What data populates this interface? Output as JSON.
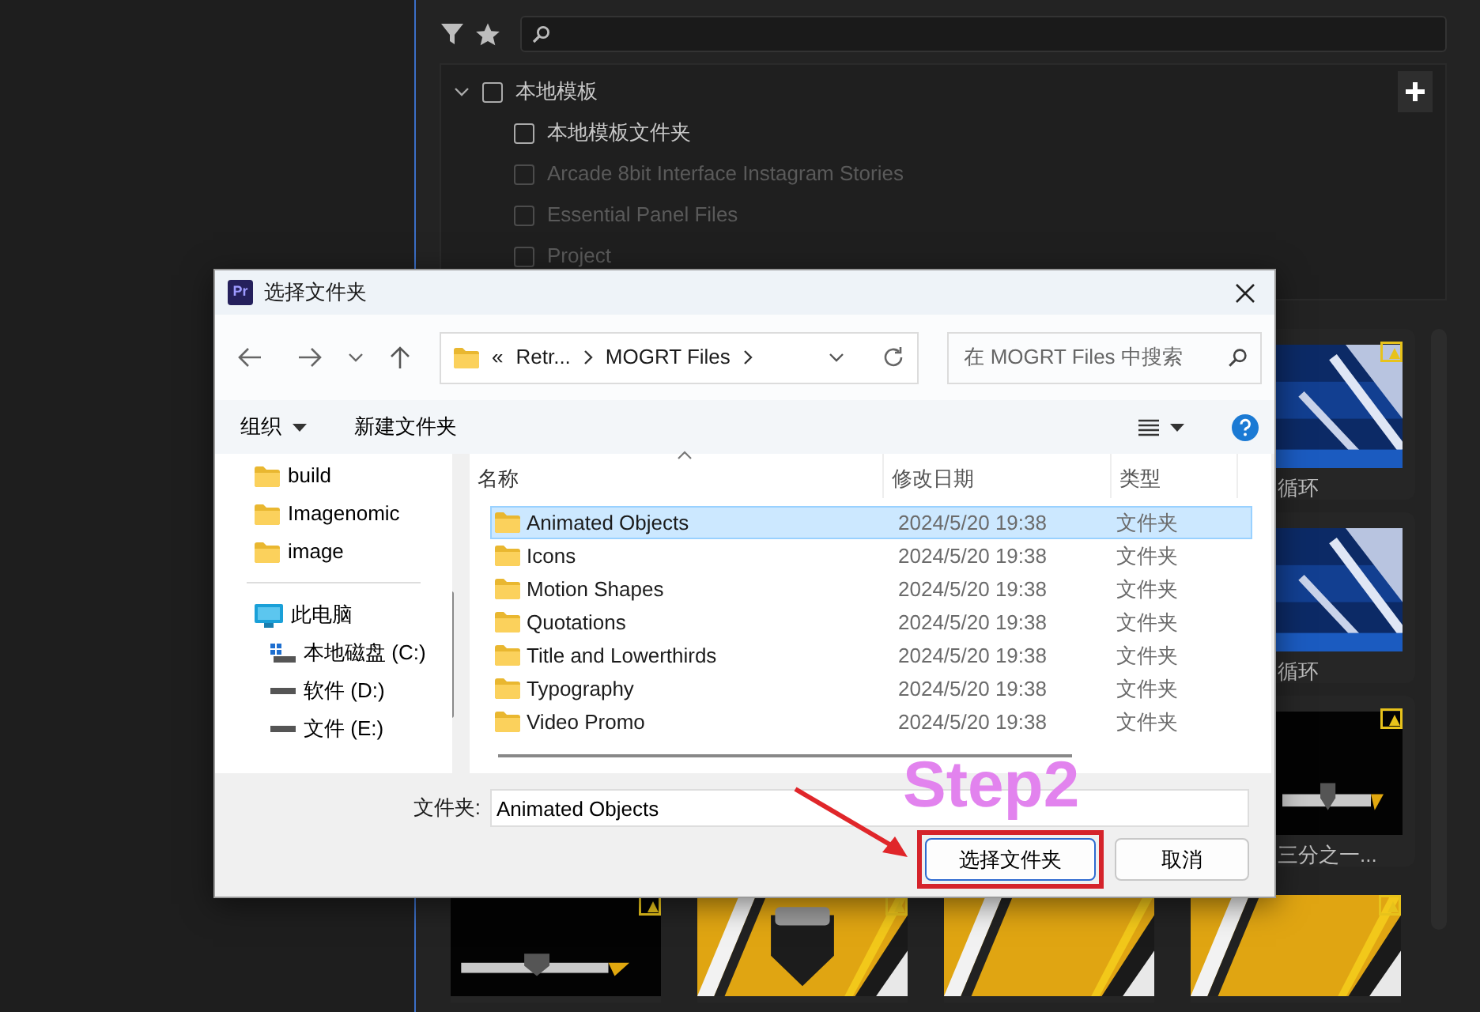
{
  "panel": {
    "tree": {
      "label": "本地模板",
      "expanded": true,
      "checked": false,
      "children": [
        {
          "label": "本地模板文件夹",
          "checked": false,
          "disabled": false
        },
        {
          "label": "Arcade 8bit Interface Instagram Stories",
          "checked": false,
          "disabled": true
        },
        {
          "label": "Essential Panel Files",
          "checked": false,
          "disabled": true
        },
        {
          "label": "Project",
          "checked": false,
          "disabled": true
        }
      ]
    },
    "side_thumbnails": [
      {
        "caption": "循环",
        "badge": true
      },
      {
        "caption": "循环",
        "badge": false
      },
      {
        "caption": "三分之一...",
        "badge": true
      }
    ],
    "bottom_thumbnails": [
      {
        "badge": true
      },
      {
        "badge": true
      },
      {
        "badge": false
      },
      {
        "badge": true
      }
    ]
  },
  "dialog": {
    "app_icon": "Pr",
    "title": "选择文件夹",
    "address": {
      "overflow": "«",
      "crumbs": [
        "Retr...",
        "MOGRT Files"
      ]
    },
    "search": {
      "placeholder": "在 MOGRT Files 中搜索"
    },
    "toolbar": {
      "organize": "组织",
      "new_folder": "新建文件夹"
    },
    "quick_access": [
      {
        "label": "build"
      },
      {
        "label": "Imagenomic"
      },
      {
        "label": "image"
      }
    ],
    "this_pc": {
      "label": "此电脑",
      "drives": [
        {
          "label": "本地磁盘 (C:)",
          "kind": "system"
        },
        {
          "label": "软件 (D:)",
          "kind": "drive"
        },
        {
          "label": "文件 (E:)",
          "kind": "drive"
        }
      ]
    },
    "columns": [
      {
        "label": "名称",
        "sorted": true
      },
      {
        "label": "修改日期",
        "sorted": false
      },
      {
        "label": "类型",
        "sorted": false
      }
    ],
    "rows": [
      {
        "name": "Animated Objects",
        "modified": "2024/5/20 19:38",
        "type": "文件夹",
        "selected": true
      },
      {
        "name": "Icons",
        "modified": "2024/5/20 19:38",
        "type": "文件夹",
        "selected": false
      },
      {
        "name": "Motion Shapes",
        "modified": "2024/5/20 19:38",
        "type": "文件夹",
        "selected": false
      },
      {
        "name": "Quotations",
        "modified": "2024/5/20 19:38",
        "type": "文件夹",
        "selected": false
      },
      {
        "name": "Title and Lowerthirds",
        "modified": "2024/5/20 19:38",
        "type": "文件夹",
        "selected": false
      },
      {
        "name": "Typography",
        "modified": "2024/5/20 19:38",
        "type": "文件夹",
        "selected": false
      },
      {
        "name": "Video Promo",
        "modified": "2024/5/20 19:38",
        "type": "文件夹",
        "selected": false
      }
    ],
    "folder_field": {
      "label": "文件夹:",
      "value": "Animated Objects"
    },
    "buttons": [
      {
        "label": "选择文件夹",
        "kind": "primary",
        "highlighted": true
      },
      {
        "label": "取消",
        "kind": "secondary",
        "highlighted": false
      }
    ]
  },
  "annotation": {
    "text": "Step2"
  }
}
